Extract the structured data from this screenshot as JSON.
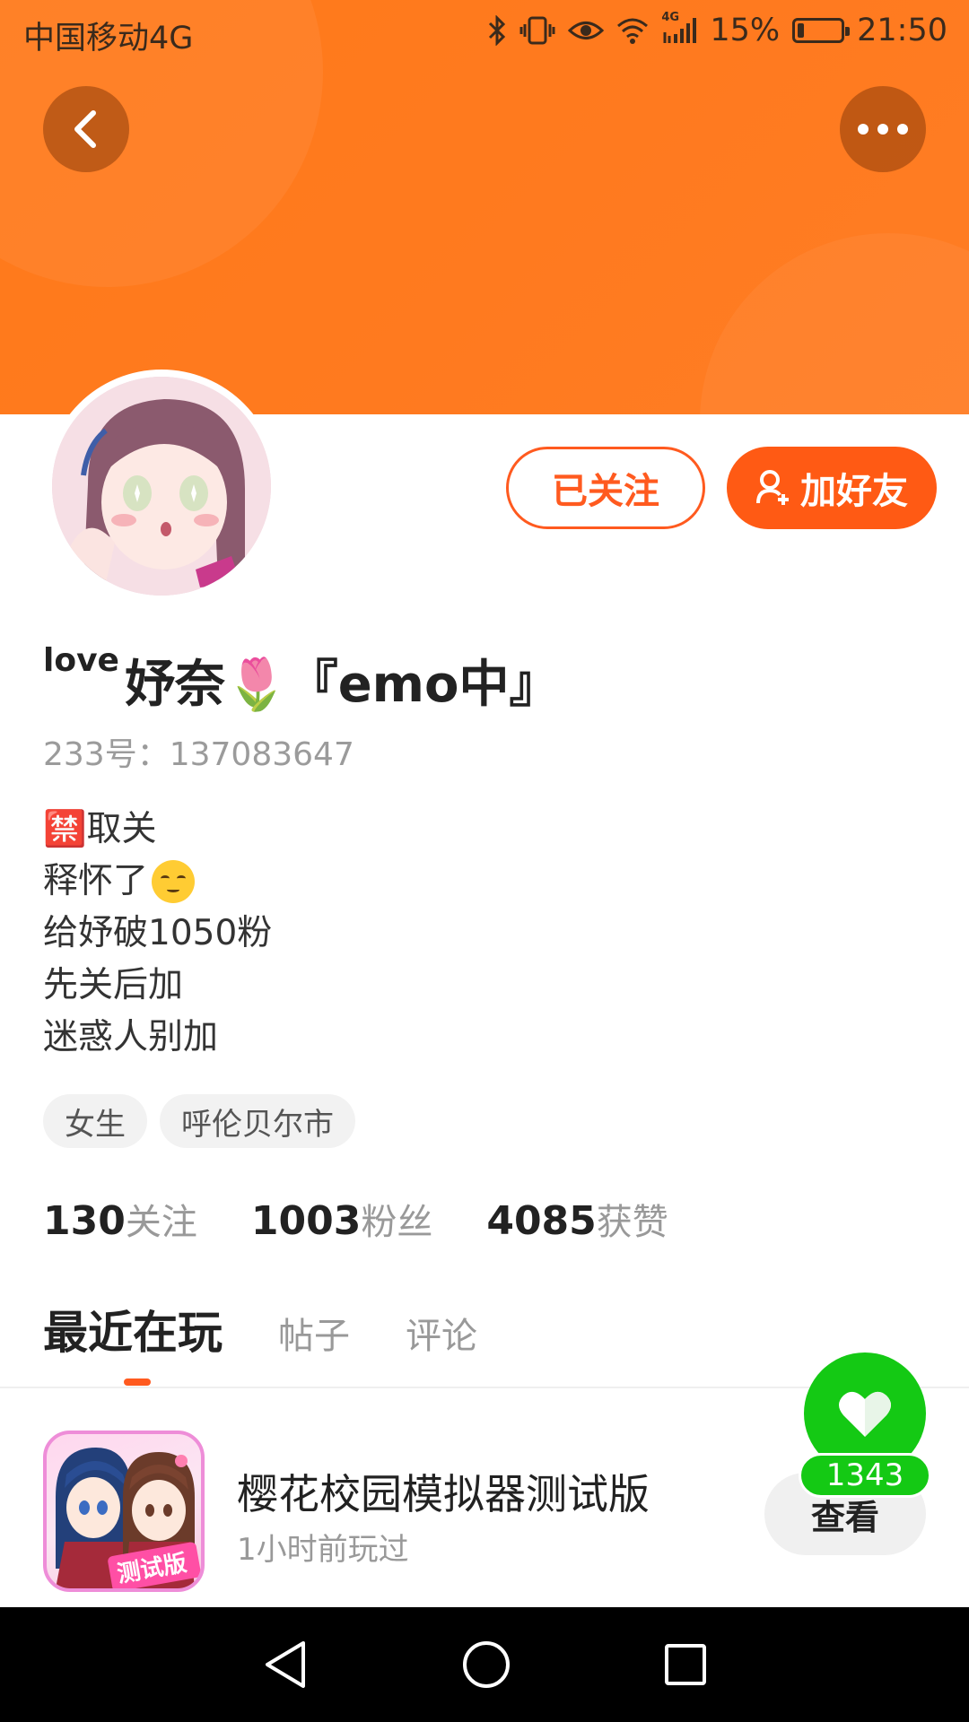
{
  "status_bar": {
    "carrier": "中国移动4G",
    "battery": "15%",
    "battery_level": 0.15,
    "time": "21:50",
    "network_badge": "4G",
    "icons": [
      "bluetooth-icon",
      "vibrate-icon",
      "eye-icon",
      "wifi-icon",
      "signal-icon",
      "battery-icon"
    ]
  },
  "header": {
    "back_icon": "chevron-left-icon",
    "more_icon": "more-dots-icon",
    "banner_color": "#ff7a1a"
  },
  "profile": {
    "name_prefix": "love",
    "name_main": "妤奈🌷『emo中』",
    "user_id": "233号：137083647",
    "bio_lines": [
      "🈲取关",
      "释怀了",
      "给妤破1050粉",
      "先关后加",
      "迷惑人别加"
    ],
    "ban_badge": "禁",
    "tags": [
      "女生",
      "呼伦贝尔市"
    ]
  },
  "actions": {
    "follow_label": "已关注",
    "add_friend_label": "加好友",
    "accent_color": "#ff5a14"
  },
  "stats": [
    {
      "num": "130",
      "label": "关注"
    },
    {
      "num": "1003",
      "label": "粉丝"
    },
    {
      "num": "4085",
      "label": "获赞"
    }
  ],
  "tabs": [
    {
      "label": "最近在玩",
      "active": true
    },
    {
      "label": "帖子",
      "active": false
    },
    {
      "label": "评论",
      "active": false
    }
  ],
  "recent_game": {
    "title": "樱花校园模拟器测试版",
    "played": "1小时前玩过",
    "icon_badge": "测试版",
    "view_label": "查看"
  },
  "like": {
    "count": "1343",
    "color": "#14c914"
  },
  "nav": {
    "icons": [
      "back-triangle-icon",
      "home-circle-icon",
      "recents-square-icon"
    ]
  }
}
